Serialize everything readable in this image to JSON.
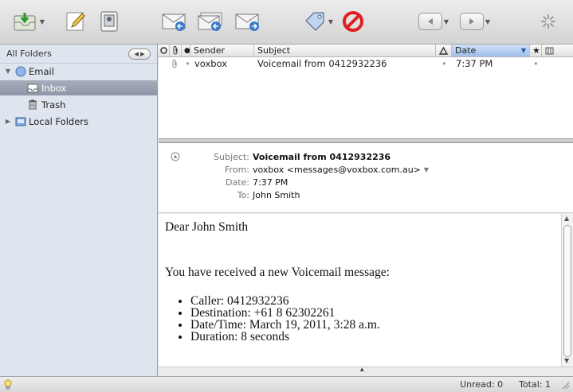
{
  "sidebar": {
    "header": "All Folders",
    "items": [
      {
        "label": "Email",
        "expanded": true
      },
      {
        "label": "Inbox",
        "selected": true
      },
      {
        "label": "Trash"
      },
      {
        "label": "Local Folders",
        "expanded": false
      }
    ]
  },
  "list": {
    "columns": [
      "Sender",
      "Subject",
      "Date"
    ],
    "messages": [
      {
        "sender": "voxbox",
        "subject": "Voicemail from 0412932236",
        "date": "7:37 PM",
        "dot": "•"
      }
    ]
  },
  "header": {
    "subject_label": "Subject:",
    "subject": "Voicemail from 0412932236",
    "from_label": "From:",
    "from": "voxbox <messages@voxbox.com.au>",
    "date_label": "Date:",
    "date": "7:37 PM",
    "to_label": "To:",
    "to": "John Smith"
  },
  "body": {
    "greeting": "Dear John Smith",
    "intro": "You have received a new Voicemail message:",
    "items": [
      "Caller: 0412932236",
      "Destination: +61 8 62302261",
      "Date/Time: March 19, 2011, 3:28 a.m.",
      "Duration: 8 seconds"
    ]
  },
  "status": {
    "unread": "Unread: 0",
    "total": "Total: 1"
  },
  "colors": {
    "sidebar_bg": "#dfe5ee",
    "selection": "#8d96a7",
    "date_header": "#9fbfe9",
    "stop_red": "#e02020"
  },
  "icons": [
    "get-mail-icon",
    "compose-icon",
    "address-book-icon",
    "reply-icon",
    "reply-all-icon",
    "forward-icon",
    "tag-icon",
    "junk-icon",
    "back-icon",
    "forward-nav-icon",
    "activity-spinner-icon"
  ]
}
